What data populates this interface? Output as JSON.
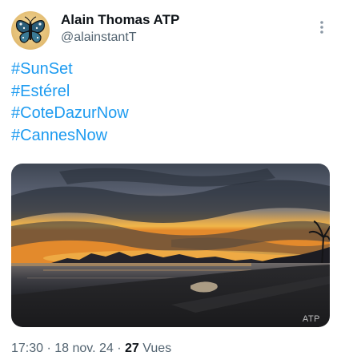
{
  "author": {
    "display_name": "Alain Thomas ATP",
    "handle": "@alainstantT",
    "avatar_icon": "butterfly-avatar"
  },
  "menu": {
    "icon": "more-vertical-icon"
  },
  "tweet": {
    "hashtags": [
      "#SunSet",
      "#Estérel",
      "#CoteDazurNow",
      "#CannesNow"
    ]
  },
  "media": {
    "watermark": "ATP"
  },
  "meta": {
    "time": "17:30",
    "separator1": " · ",
    "date": "18 nov. 24",
    "separator2": " · ",
    "views_count": "27",
    "views_label": " Vues"
  },
  "colors": {
    "link": "#1d9bf0",
    "secondary_text": "#536471",
    "primary_text": "#0f1419"
  }
}
